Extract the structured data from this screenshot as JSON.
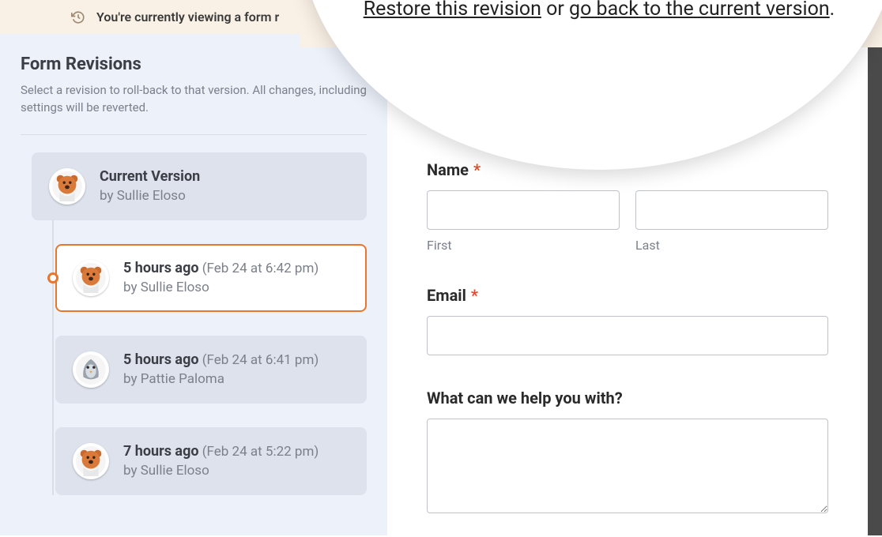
{
  "notice": {
    "truncated_text": "You're currently viewing a form r"
  },
  "zoom": {
    "restore_link": "Restore this revision",
    "middle_text": " or ",
    "goback_link": "go back to the current version",
    "period": "."
  },
  "sidebar": {
    "title": "Form Revisions",
    "description": "Select a revision to roll-back to that version. All changes, including settings will be reverted."
  },
  "revisions": [
    {
      "primary": "Current Version",
      "date": "",
      "by": "by Sullie Eloso",
      "avatar": "bear",
      "selected": false,
      "indented": false
    },
    {
      "primary": "5 hours ago",
      "date": "(Feb 24 at 6:42 pm)",
      "by": "by Sullie Eloso",
      "avatar": "bear",
      "selected": true,
      "indented": true
    },
    {
      "primary": "5 hours ago",
      "date": "(Feb 24 at 6:41 pm)",
      "by": "by Pattie Paloma",
      "avatar": "bird",
      "selected": false,
      "indented": true
    },
    {
      "primary": "7 hours ago",
      "date": "(Feb 24 at 5:22 pm)",
      "by": "by Sullie Eloso",
      "avatar": "bear",
      "selected": false,
      "indented": true
    }
  ],
  "form": {
    "name_label": "Name",
    "first_sublabel": "First",
    "last_sublabel": "Last",
    "email_label": "Email",
    "help_label": "What can we help you with?"
  }
}
